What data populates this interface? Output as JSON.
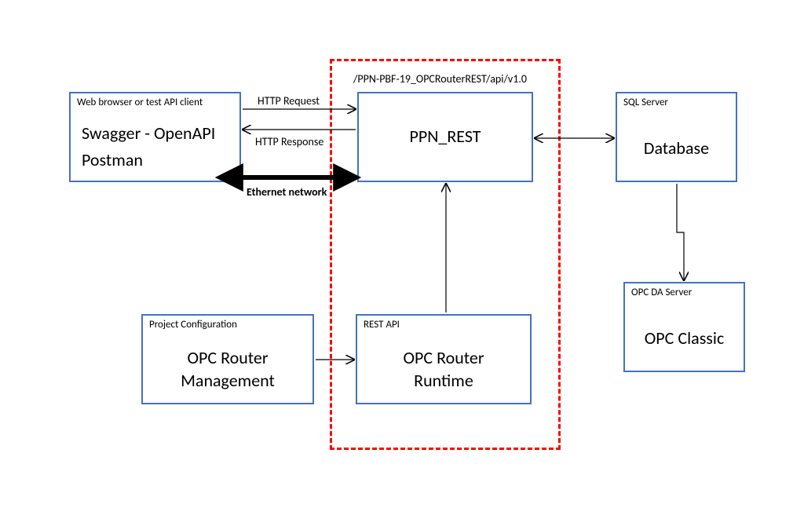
{
  "dashed_url": "/PPN-PBF-19_OPCRouterREST/api/v1.0",
  "client_box": {
    "title": "Web browser or test API client",
    "line1": "Swagger - OpenAPI",
    "line2": "Postman"
  },
  "ppn_rest_box": {
    "main": "PPN_REST"
  },
  "sql_box": {
    "title": "SQL Server",
    "main": "Database"
  },
  "opcda_box": {
    "title": "OPC DA Server",
    "main": "OPC Classic"
  },
  "mgmt_box": {
    "title": "Project Configuration",
    "line1": "OPC Router",
    "line2": "Management"
  },
  "runtime_box": {
    "title": "REST API",
    "line1": "OPC Router",
    "line2": "Runtime"
  },
  "labels": {
    "http_request": "HTTP Request",
    "http_response": "HTTP Response",
    "ethernet": "Ethernet network"
  }
}
